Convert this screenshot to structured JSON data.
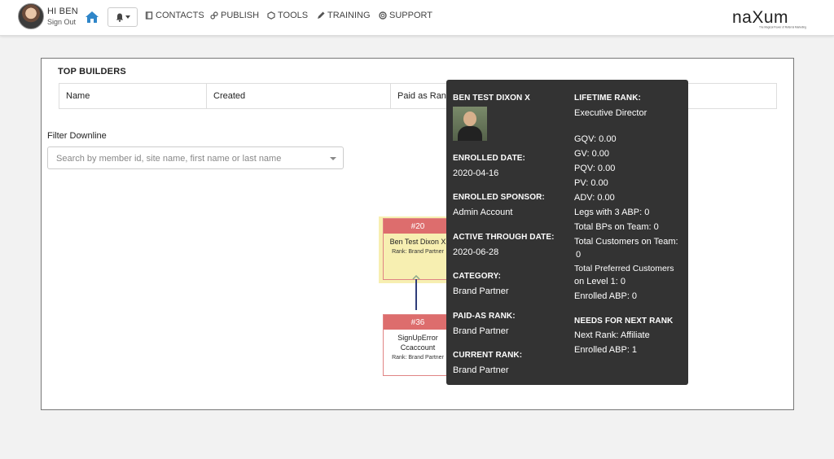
{
  "header": {
    "greeting": "HI BEN",
    "sign_out": "Sign Out",
    "nav": [
      {
        "label": "CONTACTS",
        "icon": "book-icon"
      },
      {
        "label": "PUBLISH",
        "icon": "link-icon"
      },
      {
        "label": "TOOLS",
        "icon": "tools-icon"
      },
      {
        "label": "TRAINING",
        "icon": "pencil-icon"
      },
      {
        "label": "SUPPORT",
        "icon": "lifebuoy-icon"
      }
    ],
    "logo": "naXum",
    "logo_tagline": "The Magical Power of Referral Marketing"
  },
  "top_builders": {
    "title": "TOP BUILDERS",
    "columns": [
      "Name",
      "Created",
      "Paid as Rank"
    ]
  },
  "filter": {
    "label": "Filter Downline",
    "placeholder": "Search by member id, site name, first name or last name"
  },
  "tree": {
    "nodes": [
      {
        "id": "#20",
        "name": "Ben Test Dixon X",
        "rank": "Rank: Brand Partner"
      },
      {
        "id": "#36",
        "name": "SignUpError Ccaccount",
        "rank": "Rank: Brand Partner"
      }
    ]
  },
  "tooltip": {
    "name": "BEN TEST DIXON X",
    "enrolled_date_label": "ENROLLED DATE:",
    "enrolled_date": "2020-04-16",
    "enrolled_sponsor_label": "ENROLLED SPONSOR:",
    "enrolled_sponsor": "Admin Account",
    "active_through_label": "ACTIVE THROUGH DATE:",
    "active_through": "2020-06-28",
    "category_label": "CATEGORY:",
    "category": "Brand Partner",
    "paid_as_rank_label": "PAID-AS RANK:",
    "paid_as_rank": "Brand Partner",
    "current_rank_label": "CURRENT RANK:",
    "current_rank": "Brand Partner",
    "lifetime_rank_label": "LIFETIME RANK:",
    "lifetime_rank": "Executive Director",
    "stats": [
      "GQV:  0.00",
      "GV:  0.00",
      "PQV:  0.00",
      "PV:  0.00",
      "ADV:  0.00",
      "Legs with 3 ABP:  0",
      "Total BPs on Team:  0",
      "Total Customers on Team:",
      "0",
      "Total Preferred Customers",
      "on Level 1:  0",
      "Enrolled ABP:  0"
    ],
    "needs_label": "NEEDS FOR NEXT RANK",
    "next_rank": "Next Rank:  Affiliate",
    "next_enrolled_abp": "Enrolled ABP:  1"
  },
  "colors": {
    "node_header": "#dd6d6d",
    "node_highlight": "#f7efb1",
    "tooltip_bg": "#333333",
    "home_icon": "#2f86c9",
    "connector": "#2f3d7a"
  }
}
